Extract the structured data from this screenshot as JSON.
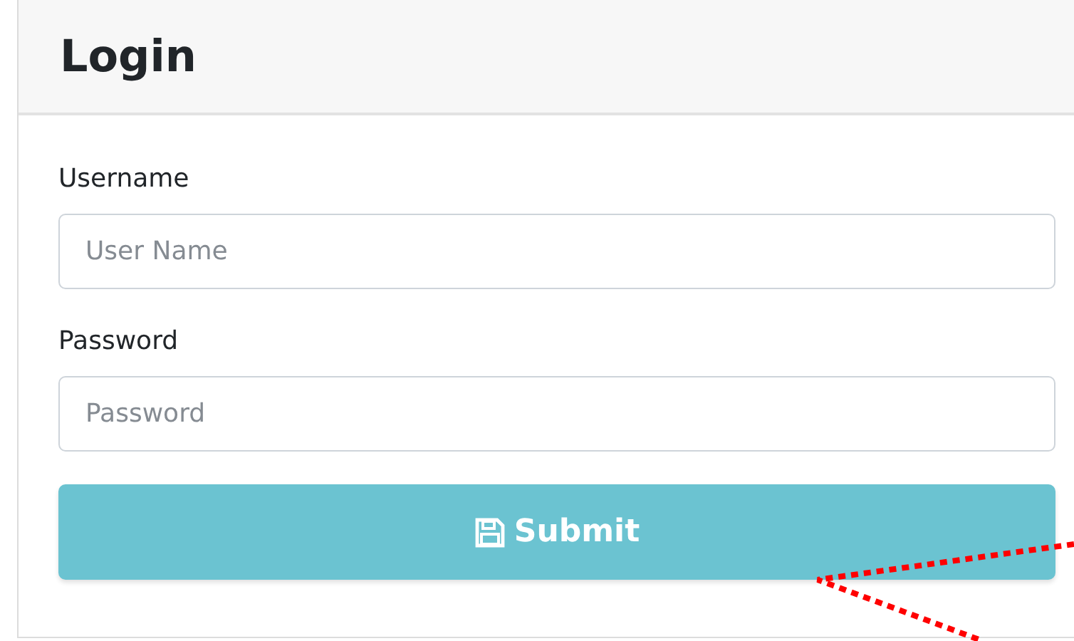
{
  "card": {
    "title": "Login"
  },
  "fields": [
    {
      "label": "Username",
      "placeholder": "User Name"
    },
    {
      "label": "Password",
      "placeholder": "Password"
    }
  ],
  "submit_button": {
    "label": "Submit"
  }
}
